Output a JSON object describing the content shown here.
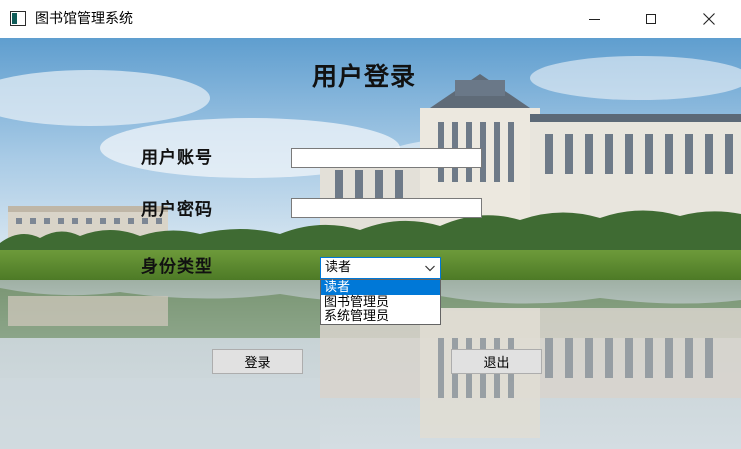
{
  "window": {
    "title": "图书馆管理系统",
    "icon": "app-window-icon"
  },
  "form": {
    "title": "用户登录",
    "account_label": "用户账号",
    "account_value": "",
    "password_label": "用户密码",
    "password_value": "",
    "role_label": "身份类型",
    "role_selected": "读者",
    "role_options": [
      "读者",
      "图书管理员",
      "系统管理员"
    ],
    "highlighted_option_index": 0
  },
  "buttons": {
    "login": "登录",
    "exit": "退出"
  },
  "colors": {
    "accent": "#0078d7",
    "button_bg": "#e1e1e1",
    "button_border": "#adadad"
  }
}
